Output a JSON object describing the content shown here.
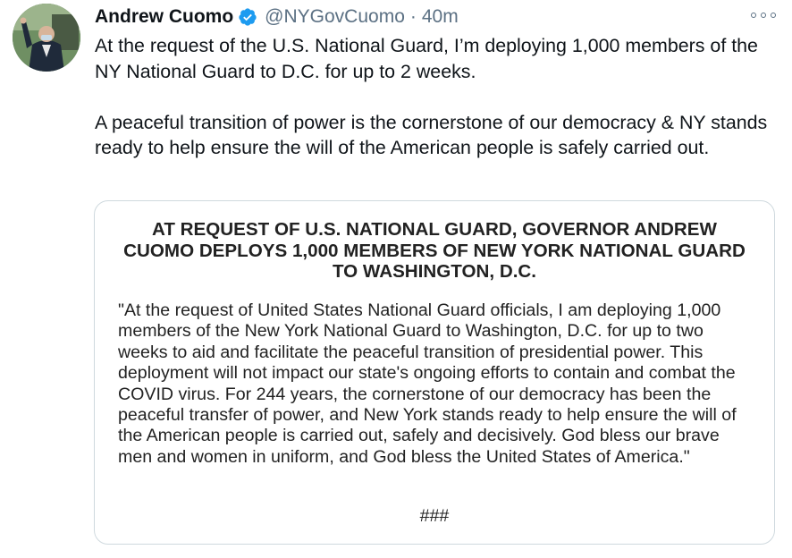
{
  "author": {
    "display_name": "Andrew Cuomo",
    "handle": "@NYGovCuomo",
    "separator": "·",
    "timestamp": "40m",
    "verified": true,
    "verified_color": "#1d9bf0"
  },
  "tweet": {
    "paragraph_1": "At the request of the U.S. National Guard, I’m deploying 1,000 members of the NY National Guard to D.C. for up to 2 weeks.",
    "paragraph_2": "A peaceful transition of power is the cornerstone of our democracy & NY stands ready to help ensure the will of the American people is safely carried out."
  },
  "media": {
    "headline": "AT REQUEST OF U.S. NATIONAL GUARD, GOVERNOR ANDREW CUOMO DEPLOYS 1,000 MEMBERS OF NEW YORK NATIONAL GUARD TO WASHINGTON, D.C.",
    "body": "\"At the request of United States National Guard officials, I am deploying 1,000 members of the New York National Guard to Washington, D.C. for up to two weeks to aid and facilitate the peaceful transition of presidential power. This deployment will not impact our state's ongoing efforts to contain and combat the COVID virus. For 244 years, the cornerstone of our democracy has been the peaceful transfer of power, and New York stands ready to help ensure the will of the American people is carried out, safely and decisively. God bless our brave men and women in uniform, and God bless the United States of America.\"",
    "end_mark": "###"
  },
  "icons": {
    "avatar": "avatar",
    "verified": "verified-badge-icon",
    "more": "more-options-icon"
  }
}
